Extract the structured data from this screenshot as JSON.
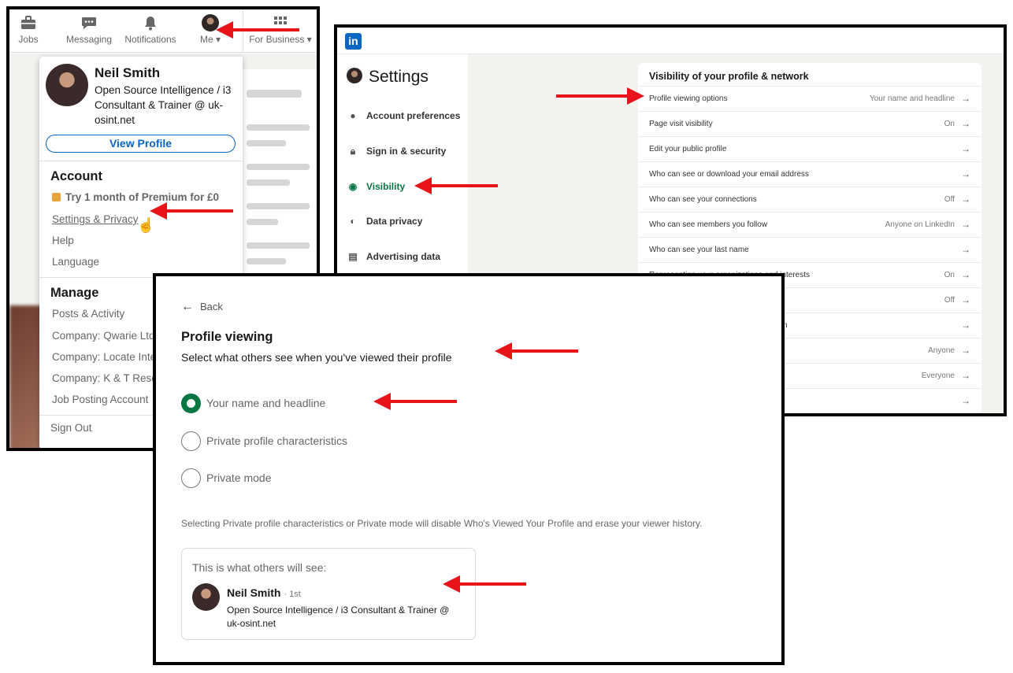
{
  "colors": {
    "linkedin_blue": "#0a66c2",
    "visibility_green": "#057642",
    "annotation_red": "#e8141a",
    "premium_gold": "#e7a33e"
  },
  "nav": {
    "jobs": "Jobs",
    "messaging": "Messaging",
    "notifications": "Notifications",
    "me": "Me",
    "for_business": "For Business"
  },
  "dropdown": {
    "name": "Neil Smith",
    "headline": "Open Source Intelligence / i3 Consultant & Trainer @ uk-osint.net",
    "view_profile": "View Profile",
    "account_heading": "Account",
    "premium": "Try 1 month of Premium for £0",
    "settings_privacy": "Settings & Privacy",
    "help": "Help",
    "language": "Language",
    "manage_heading": "Manage",
    "posts_activity": "Posts & Activity",
    "company_1": "Company: Qwarie Ltd",
    "company_2": "Company: Locate Inte",
    "company_3": "Company: K & T Resea",
    "job_posting": "Job Posting Account",
    "sign_out": "Sign Out"
  },
  "settings": {
    "logo": "in",
    "title": "Settings",
    "side_items": [
      {
        "icon": "person-icon",
        "label": "Account preferences"
      },
      {
        "icon": "lock-icon",
        "label": "Sign in & security"
      },
      {
        "icon": "eye-icon",
        "label": "Visibility"
      },
      {
        "icon": "shield-icon",
        "label": "Data privacy"
      },
      {
        "icon": "ad-icon",
        "label": "Advertising data"
      }
    ],
    "section_title": "Visibility of your profile & network",
    "rows": [
      {
        "label": "Profile viewing options",
        "value": "Your name and headline"
      },
      {
        "label": "Page visit visibility",
        "value": "On"
      },
      {
        "label": "Edit your public profile",
        "value": ""
      },
      {
        "label": "Who can see or download your email address",
        "value": ""
      },
      {
        "label": "Who can see your connections",
        "value": "Off"
      },
      {
        "label": "Who can see members you follow",
        "value": "Anyone on LinkedIn"
      },
      {
        "label": "Who can see your last name",
        "value": ""
      },
      {
        "label": "Representing your organizations and interests",
        "value": "On"
      },
      {
        "label": "",
        "value": "Off"
      },
      {
        "label": "n",
        "value": ""
      },
      {
        "label": "",
        "value": "Anyone"
      },
      {
        "label": "",
        "value": "Everyone"
      },
      {
        "label": "",
        "value": ""
      }
    ]
  },
  "profile_viewing": {
    "back": "Back",
    "title": "Profile viewing",
    "subtitle": "Select what others see when you've viewed their profile",
    "options": [
      {
        "label": "Your name and headline",
        "selected": true
      },
      {
        "label": "Private profile characteristics",
        "selected": false
      },
      {
        "label": "Private mode",
        "selected": false
      }
    ],
    "note": "Selecting Private profile characteristics or Private mode will disable Who's Viewed Your Profile and erase your viewer history.",
    "preview_title": "This is what others will see:",
    "preview_name": "Neil Smith",
    "preview_degree": "· 1st",
    "preview_headline": "Open Source Intelligence / i3 Consultant & Trainer @ uk-osint.net"
  }
}
